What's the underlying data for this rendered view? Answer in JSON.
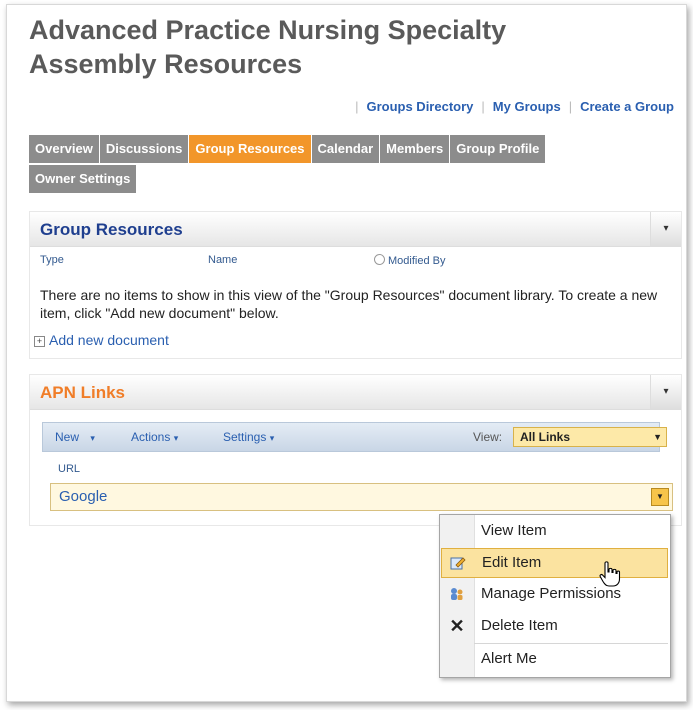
{
  "page": {
    "title": "Advanced Practice Nursing Specialty Assembly Resources"
  },
  "top_links": [
    "Groups Directory",
    "My Groups",
    "Create a Group"
  ],
  "tabs": [
    {
      "label": "Overview",
      "active": false
    },
    {
      "label": "Discussions",
      "active": false
    },
    {
      "label": "Group Resources",
      "active": true
    },
    {
      "label": "Calendar",
      "active": false
    },
    {
      "label": "Members",
      "active": false
    },
    {
      "label": "Group Profile",
      "active": false
    },
    {
      "label": "Owner Settings",
      "active": false
    }
  ],
  "group_resources": {
    "title": "Group Resources",
    "col_type": "Type",
    "col_name": "Name",
    "col_modified": "Modified By",
    "empty_message": "There are no items to show in this view of the \"Group Resources\" document library. To create a new item, click \"Add new document\" below.",
    "add_new": "Add new document",
    "menu_arrow": "▾"
  },
  "apn_links": {
    "title": "APN Links",
    "toolbar": {
      "new": "New",
      "actions": "Actions",
      "settings": "Settings",
      "view_label": "View:",
      "view_value": "All Links"
    },
    "col_url": "URL",
    "rows": [
      {
        "url": "Google"
      }
    ],
    "menu_arrow": "▾"
  },
  "context_menu": {
    "items": [
      {
        "label": "View Item",
        "icon": "none"
      },
      {
        "label": "Edit Item",
        "icon": "edit-icon",
        "highlighted": true
      },
      {
        "label": "Manage Permissions",
        "icon": "permissions-icon"
      },
      {
        "label": "Delete Item",
        "icon": "delete-icon"
      },
      {
        "label": "Alert Me",
        "icon": "none"
      }
    ]
  },
  "colors": {
    "tab_active": "#f2962a",
    "tab_inactive": "#8c8c8c",
    "title_blue": "#1f3f8f",
    "apn_orange": "#f07d28",
    "link_blue": "#2a5fb0",
    "menu_highlight": "#fbe3a0"
  }
}
